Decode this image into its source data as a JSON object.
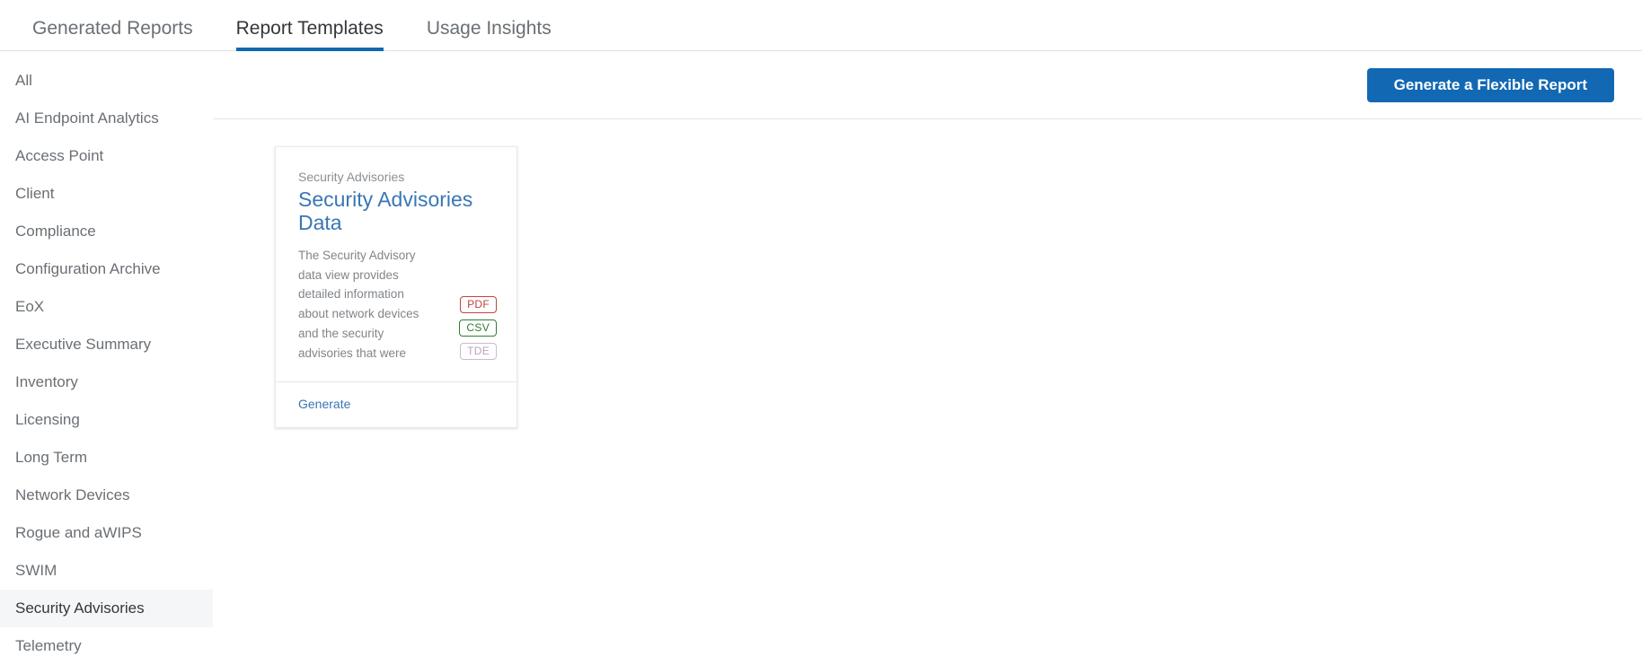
{
  "tabs": [
    {
      "label": "Generated Reports",
      "active": false
    },
    {
      "label": "Report Templates",
      "active": true
    },
    {
      "label": "Usage Insights",
      "active": false
    }
  ],
  "sidebar": {
    "items": [
      {
        "label": "All",
        "selected": false
      },
      {
        "label": "AI Endpoint Analytics",
        "selected": false
      },
      {
        "label": "Access Point",
        "selected": false
      },
      {
        "label": "Client",
        "selected": false
      },
      {
        "label": "Compliance",
        "selected": false
      },
      {
        "label": "Configuration Archive",
        "selected": false
      },
      {
        "label": "EoX",
        "selected": false
      },
      {
        "label": "Executive Summary",
        "selected": false
      },
      {
        "label": "Inventory",
        "selected": false
      },
      {
        "label": "Licensing",
        "selected": false
      },
      {
        "label": "Long Term",
        "selected": false
      },
      {
        "label": "Network Devices",
        "selected": false
      },
      {
        "label": "Rogue and aWIPS",
        "selected": false
      },
      {
        "label": "SWIM",
        "selected": false
      },
      {
        "label": "Security Advisories",
        "selected": true
      },
      {
        "label": "Telemetry",
        "selected": false
      }
    ]
  },
  "toolbar": {
    "generate_flexible_label": "Generate a Flexible Report"
  },
  "cards": [
    {
      "category": "Security Advisories",
      "title": "Security Advisories Data",
      "description": "The Security Advisory data view provides detailed information about network devices and the security advisories that were",
      "formats": [
        {
          "label": "PDF",
          "class": "pdf"
        },
        {
          "label": "CSV",
          "class": "csv"
        },
        {
          "label": "TDE",
          "class": "tde"
        }
      ],
      "action_label": "Generate"
    }
  ],
  "colors": {
    "accent_blue": "#1268b3",
    "title_blue": "#3977b5",
    "pdf_red": "#c0443b",
    "csv_green": "#2e7d32",
    "tde_purple": "#b9a3bd",
    "selected_bg": "#f5f6f7"
  }
}
